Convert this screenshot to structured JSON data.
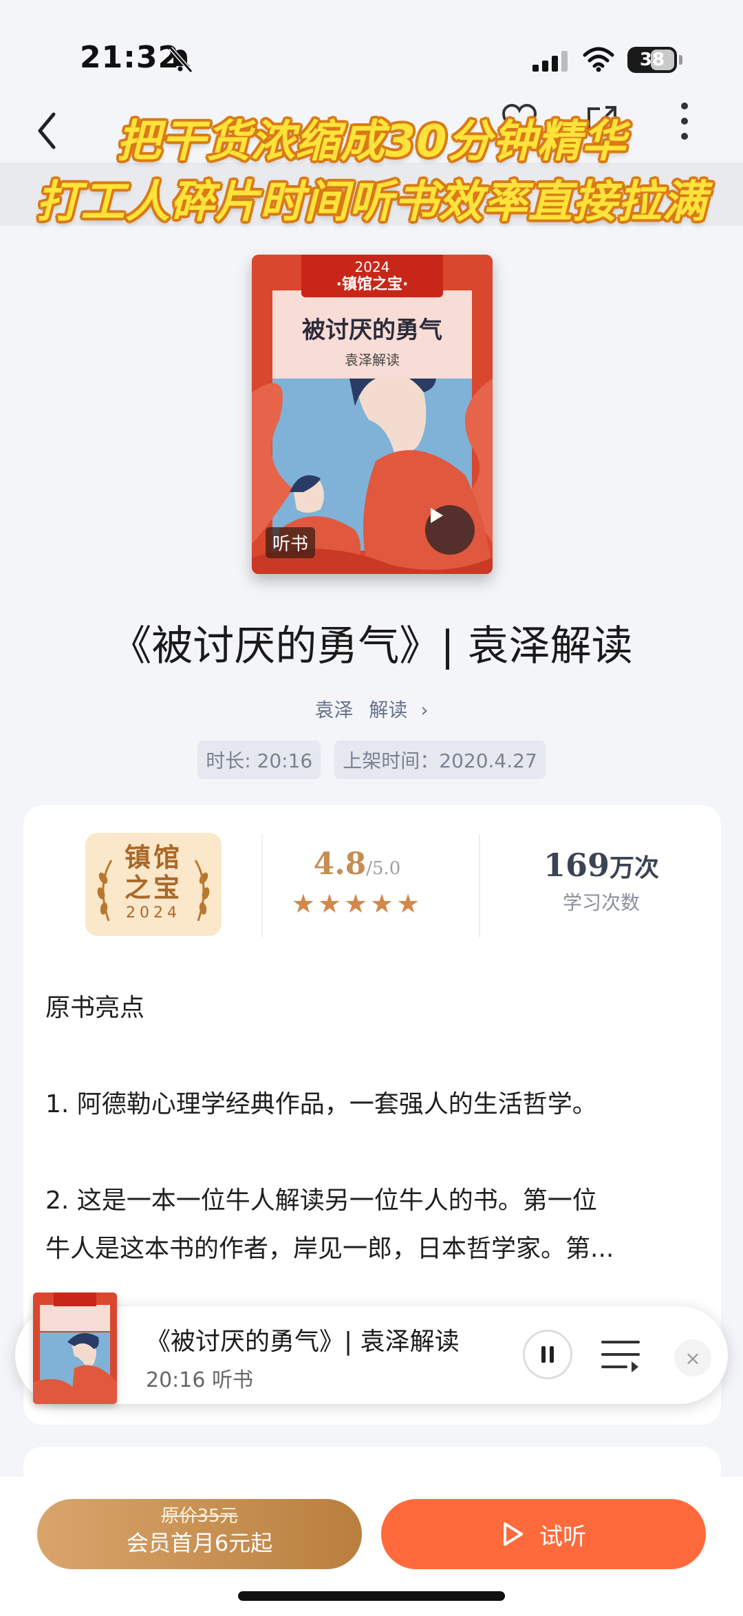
{
  "status_bar": {
    "time": "21:32",
    "battery": "38"
  },
  "caption": {
    "line1": "把干货浓缩成30分钟精华",
    "line2": "打工人碎片时间听书效率直接拉满"
  },
  "cover": {
    "year": "2024",
    "badge": "·镇馆之宝·",
    "book_title": "被讨厌的勇气",
    "book_subtitle": "袁泽解读",
    "tag": "听书"
  },
  "book": {
    "title": "《被讨厌的勇气》| 袁泽解读",
    "author": "袁泽",
    "author_role": "解读",
    "duration_label": "时长: 20:16",
    "release_label": "上架时间：2020.4.27"
  },
  "stats": {
    "award_line1": "镇馆",
    "award_line2": "之宝",
    "award_year": "2024",
    "score": "4.8",
    "score_max": "/5.0",
    "stars": "★★★★★",
    "plays_num": "169",
    "plays_unit": "万次",
    "plays_label": "学习次数"
  },
  "description": {
    "heading": "原书亮点",
    "p1": "1. 阿德勒心理学经典作品，一套强人的生活哲学。",
    "p2_line1": "2. 这是一本一位牛人解读另一位牛人的书。第一位",
    "p2_line2": "牛人是这本书的作者，岸见一郎，日本哲学家。第..."
  },
  "player": {
    "title": "《被讨厌的勇气》| 袁泽解读",
    "subtitle": "20:16 听书",
    "close": "×"
  },
  "bottom": {
    "original_price": "原价35元",
    "member_label": "会员首月6元起",
    "trial_label": "试听"
  },
  "colors": {
    "accent": "#ff6a3c",
    "gold": "#c58d52",
    "cover_red": "#d9472e"
  }
}
